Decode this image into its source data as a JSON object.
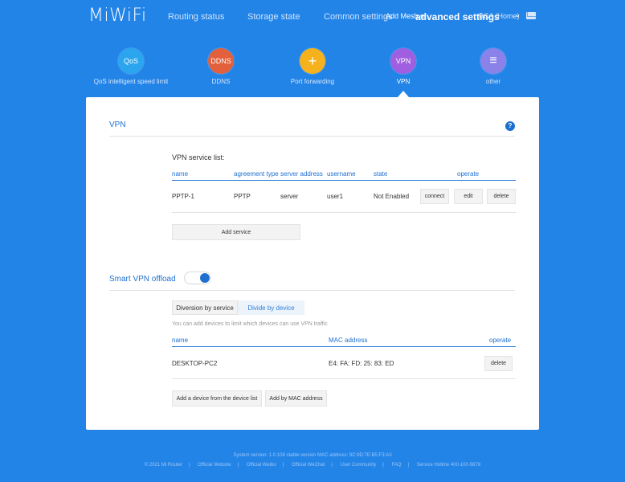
{
  "header": {
    "logo": "MiWiFi",
    "nav": [
      "Routing status",
      "Storage state",
      "Common settings"
    ],
    "overlap_item": "Add Mesh n",
    "active_nav": "advanced settings",
    "network_fragment": "BCA (Home)",
    "chevron": "⌄",
    "mail_icon": "mail-icon"
  },
  "features": [
    {
      "icon_text": "QoS",
      "label": "QoS intelligent speed limit",
      "color": "#2aa5ee"
    },
    {
      "icon_text": "DDNS",
      "label": "DDNS",
      "color": "#e2603b"
    },
    {
      "icon_text": "+",
      "label": "Port forwarding",
      "color": "#f5b21c"
    },
    {
      "icon_text": "VPN",
      "label": "VPN",
      "color": "#a05ee0"
    },
    {
      "icon_text": "≡",
      "label": "other",
      "color": "#8a82e8"
    }
  ],
  "vpn": {
    "title": "VPN",
    "help": "?",
    "list_label": "VPN service list:",
    "columns": [
      "name",
      "agreement type",
      "server address",
      "username",
      "state",
      "operate"
    ],
    "rows": [
      {
        "name": "PPTP-1",
        "type": "PPTP",
        "server": "server",
        "username": "user1",
        "state": "Not Enabled"
      }
    ],
    "row_actions": [
      "connect",
      "edit",
      "delete"
    ],
    "add_service": "Add service"
  },
  "smart": {
    "title": "Smart VPN offload",
    "toggle_on": true,
    "tabs": [
      "Diversion by service",
      "Divide by device"
    ],
    "hint": "You can add devices to limit which devices can use VPN traffic",
    "columns": [
      "name",
      "MAC address",
      "operate"
    ],
    "rows": [
      {
        "name": "DESKTOP-PC2",
        "mac": "E4: FA: FD: 25: 83: ED",
        "action": "delete"
      }
    ],
    "add_from_list": "Add a device from the device list",
    "add_by_mac": "Add by MAC address"
  },
  "footer": {
    "version": "System version: 1.0.108 stable version MAC address: 9C:9D:7E:B5:F3:A3",
    "links": [
      "© 2021 Mi Router",
      "Official Website",
      "Official Weibo",
      "Official WeChat",
      "User Community",
      "FAQ",
      "Service Hotline 400-100-5678"
    ]
  },
  "colors": {
    "background": "#2384e8",
    "accent": "#1f6fd1",
    "panel": "#ffffff"
  }
}
